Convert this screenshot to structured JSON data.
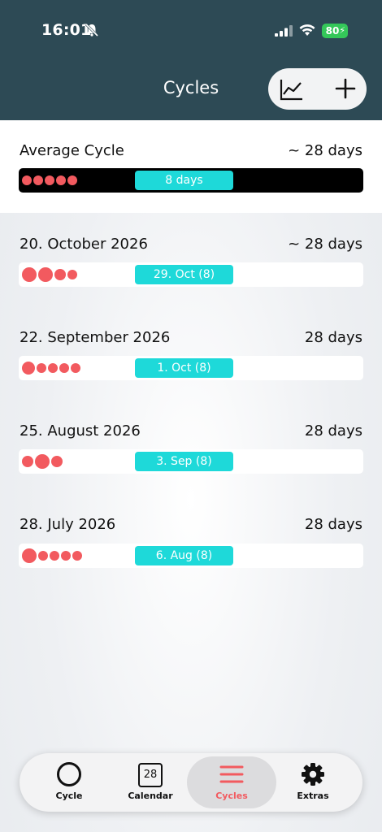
{
  "status": {
    "time": "16:01",
    "battery": "80"
  },
  "header": {
    "title": "Cycles"
  },
  "average": {
    "title": "Average Cycle",
    "length": "~ 28 days",
    "period": "8 days",
    "dots": [
      12,
      12,
      12,
      12,
      12
    ]
  },
  "cycles": [
    {
      "date": "20. October 2026",
      "length": "~ 28 days",
      "ovulation": "29. Oct (8)",
      "dots": [
        18,
        18,
        14,
        12
      ]
    },
    {
      "date": "22. September 2026",
      "length": "28 days",
      "ovulation": "1. Oct (8)",
      "dots": [
        16,
        12,
        12,
        12,
        12
      ]
    },
    {
      "date": "25. August 2026",
      "length": "28 days",
      "ovulation": "3. Sep (8)",
      "dots": [
        14,
        18,
        14
      ]
    },
    {
      "date": "28. July 2026",
      "length": "28 days",
      "ovulation": "6. Aug (8)",
      "dots": [
        18,
        12,
        12,
        12,
        12
      ]
    }
  ],
  "nav": {
    "cycle": "Cycle",
    "calendar": "Calendar",
    "calendar_day": "28",
    "cycles": "Cycles",
    "extras": "Extras"
  },
  "colors": {
    "header": "#2d4a55",
    "period": "#f25a5f",
    "ovulation": "#1ed9d9",
    "active_nav": "#f25a5f"
  }
}
